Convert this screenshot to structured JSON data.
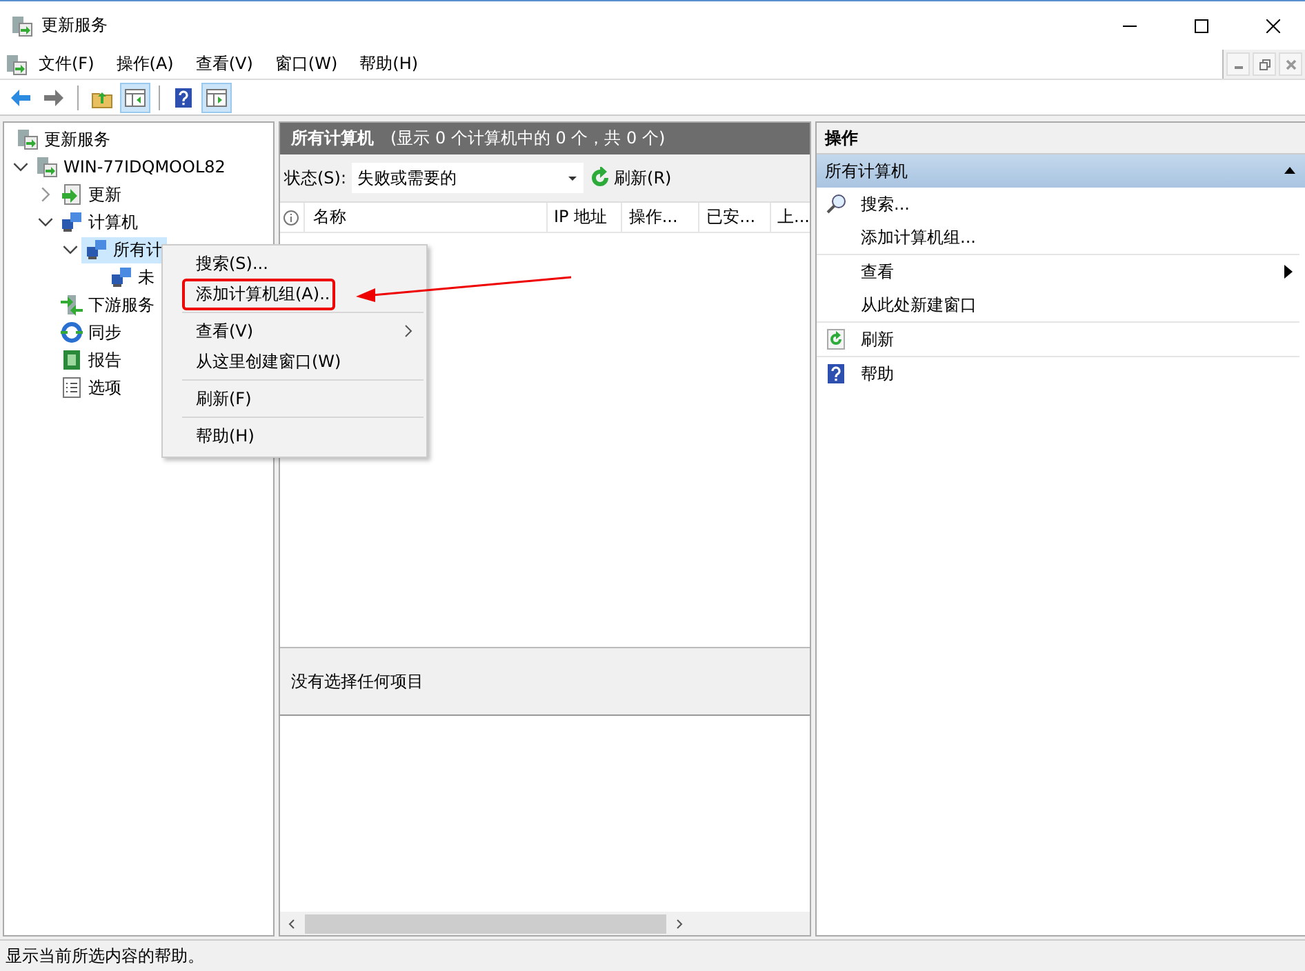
{
  "window": {
    "title": "更新服务"
  },
  "menu": [
    "文件(F)",
    "操作(A)",
    "查看(V)",
    "窗口(W)",
    "帮助(H)"
  ],
  "toolbar": [
    {
      "kind": "back",
      "pressed": false
    },
    {
      "kind": "forward",
      "pressed": false
    },
    {
      "kind": "up",
      "pressed": false
    },
    {
      "kind": "left-pane",
      "pressed": true
    },
    {
      "kind": "help",
      "pressed": false
    },
    {
      "kind": "right-pane",
      "pressed": true
    }
  ],
  "tree": [
    {
      "label": "更新服务",
      "kind": "server",
      "selected": false
    },
    {
      "label": "WIN-77IDQMOOL82",
      "kind": "server",
      "selected": false,
      "expanded": true,
      "children": [
        {
          "label": "更新",
          "kind": "update",
          "selected": false,
          "expanded": false
        },
        {
          "label": "计算机",
          "kind": "computers",
          "selected": false,
          "expanded": true,
          "children": [
            {
              "label": "所有计",
              "kind": "computers",
              "selected": true,
              "expanded": true,
              "children": [
                {
                  "label": "未",
                  "kind": "computers",
                  "selected": false
                }
              ]
            }
          ]
        },
        {
          "label": "下游服务",
          "kind": "downstream",
          "selected": false
        },
        {
          "label": "同步",
          "kind": "sync",
          "selected": false
        },
        {
          "label": "报告",
          "kind": "report",
          "selected": false
        },
        {
          "label": "选项",
          "kind": "options",
          "selected": false
        }
      ]
    }
  ],
  "panel": {
    "title": "所有计算机",
    "summary": "(显示 0 个计算机中的 0 个，共 0 个)",
    "filter_label": "状态(S):",
    "filter_value": "失败或需要的",
    "refresh": "刷新(R)",
    "columns": [
      "名称",
      "IP 地址",
      "操作...",
      "已安...",
      "上..."
    ],
    "detail": "没有选择任何项目"
  },
  "actions": {
    "title": "操作",
    "section": "所有计算机",
    "section_expanded": true,
    "groups": [
      [
        {
          "label": "搜索...",
          "kind": "search",
          "submenu": false
        },
        {
          "label": "添加计算机组...",
          "kind": "plain",
          "submenu": false
        }
      ],
      [
        {
          "label": "查看",
          "kind": "plain",
          "submenu": true
        },
        {
          "label": "从此处新建窗口",
          "kind": "plain",
          "submenu": false
        }
      ],
      [
        {
          "label": "刷新",
          "kind": "refresh",
          "submenu": false
        }
      ],
      [
        {
          "label": "帮助",
          "kind": "help",
          "submenu": false
        }
      ]
    ]
  },
  "context_menu": {
    "groups": [
      [
        {
          "label": "搜索(S)...",
          "submenu": false,
          "annotated": false
        },
        {
          "label": "添加计算机组(A)..",
          "submenu": false,
          "annotated": true
        }
      ],
      [
        {
          "label": "查看(V)",
          "submenu": true,
          "annotated": false
        },
        {
          "label": "从这里创建窗口(W)",
          "submenu": false,
          "annotated": false
        }
      ],
      [
        {
          "label": "刷新(F)",
          "submenu": false,
          "annotated": false
        }
      ],
      [
        {
          "label": "帮助(H)",
          "submenu": false,
          "annotated": false
        }
      ]
    ]
  },
  "status_bar": "显示当前所选内容的帮助。"
}
